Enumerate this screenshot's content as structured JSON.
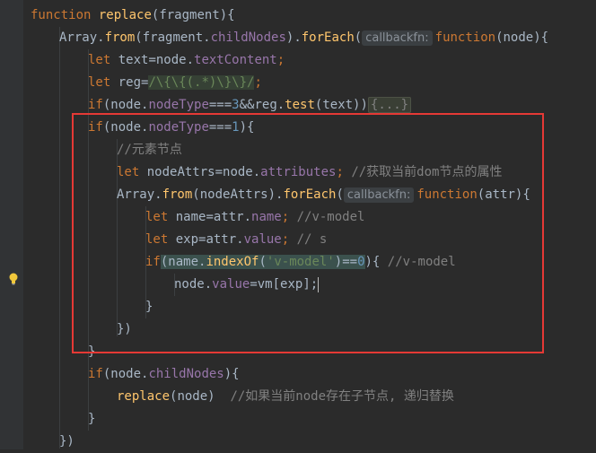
{
  "editor": {
    "hint_label": "callbackfn:",
    "folded_text": "{...}",
    "highlight_color": "#e53935",
    "lines": {
      "l1": {
        "kw": "function",
        "name": "replace",
        "params": "(fragment){"
      },
      "l2": {
        "obj": "Array.",
        "from": "from",
        "arg": "(fragment.",
        "prop": "childNodes",
        "mid": ").",
        "method": "forEach",
        "paren": "(",
        "kw": "function",
        "tail": "(node){"
      },
      "l3": {
        "kw": "let",
        "code": " text=node.",
        "prop": "textContent",
        "semi": ";"
      },
      "l4": {
        "kw": "let",
        "code": " reg=",
        "regex": "/\\{\\{(.*)\\}\\}/",
        "semi": ";"
      },
      "l5": {
        "kw": "if",
        "a": "(node.",
        "prop": "nodeType",
        "b": "===",
        "num": "3",
        "c": "&&reg.",
        "method": "test",
        "d": "(text))"
      },
      "l6": {
        "kw": "if",
        "a": "(node.",
        "prop": "nodeType",
        "b": "===",
        "num": "1",
        "c": "){"
      },
      "l7": {
        "comment": "//元素节点"
      },
      "l8": {
        "kw": "let",
        "code": " nodeAttrs=node.",
        "prop": "attributes",
        "semi": "; ",
        "comment": "//获取当前dom节点的属性"
      },
      "l9": {
        "obj": "Array.",
        "from": "from",
        "arg": "(nodeAttrs).",
        "method": "forEach",
        "paren": "(",
        "kw": "function",
        "tail": "(attr){"
      },
      "l10": {
        "kw": "let",
        "code": " name=attr.",
        "prop": "name",
        "semi": "; ",
        "comment": "//v-model"
      },
      "l11": {
        "kw": "let",
        "code": " exp=attr.",
        "prop": "value",
        "semi": "; ",
        "comment": "// s"
      },
      "l12": {
        "kw": "if",
        "a": "(",
        "obj": "name.",
        "method": "indexOf",
        "b": "(",
        "str": "'v-model'",
        "c": ")==",
        "num": "0",
        "d": "){ ",
        "comment": "//v-model"
      },
      "l13": {
        "code": "node.",
        "prop": "value",
        "tail": "=vm[exp];"
      },
      "l14": {
        "code": "}"
      },
      "l15": {
        "code": "})"
      },
      "l16": {
        "code": "}"
      },
      "l17": {
        "kw": "if",
        "a": "(node.",
        "prop": "childNodes",
        "b": "){"
      },
      "l18": {
        "fn": "replace",
        "a": "(node)  ",
        "comment": "//如果当前node存在子节点, 递归替换"
      },
      "l19": {
        "code": "}"
      },
      "l20": {
        "code": "})"
      }
    }
  }
}
